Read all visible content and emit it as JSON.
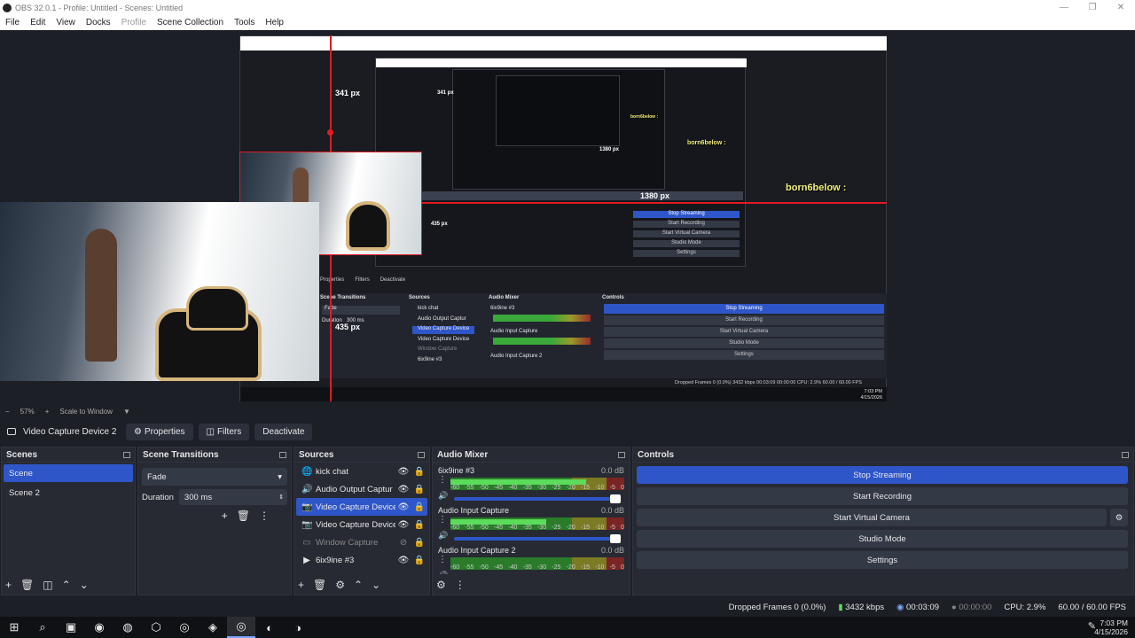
{
  "titlebar": {
    "title": "OBS 32.0.1 - Profile: Untitled - Scenes: Untitled",
    "minimize": "—",
    "maximize": "❐",
    "close": "✕"
  },
  "menu": [
    {
      "label": "File"
    },
    {
      "label": "Edit"
    },
    {
      "label": "View"
    },
    {
      "label": "Docks"
    },
    {
      "label": "Profile",
      "disabled": true
    },
    {
      "label": "Scene Collection"
    },
    {
      "label": "Tools"
    },
    {
      "label": "Help"
    }
  ],
  "preview": {
    "measure_top": "341 px",
    "measure_right": "1380 px",
    "measure_bottom": "435 px",
    "nested_measure_top": "341 px",
    "nested_measure_right": "1380 px",
    "nested_measure_bottom": "435 px",
    "chat_label_large": "born6below :",
    "chat_label_small": "born6below :",
    "chat_label_tiny": "born6below :",
    "nested_btn_stop": "Stop Streaming",
    "nested_btn_record": "Start Recording",
    "nested_btn_vcam": "Start Virtual Camera",
    "nested_btn_studio": "Studio Mode",
    "nested_btn_settings": "Settings",
    "nested_src_1": "kick chat",
    "nested_src_2": "Audio Output Captur",
    "nested_src_3": "Video Capture Device",
    "nested_src_4": "Video Capture Device",
    "nested_src_5": "Window Capture",
    "nested_src_6": "6ix9ine #3",
    "nested_status": "Dropped Frames 0 (0.0%)   3432 kbps   00:03:09   00:00:00   CPU: 2.9%   60.00 / 60.00 FPS",
    "nested_props": "Properties",
    "nested_filters": "Filters",
    "nested_deactivate": "Deactivate",
    "nested_fade": "Fade",
    "nested_duration": "Duration",
    "nested_dur_val": "300 ms",
    "nested_scene_trans": "Scene Transitions",
    "nested_sources": "Sources",
    "nested_mixer": "Audio Mixer",
    "nested_controls": "Controls",
    "nested_mix_1": "6ix9ine #3",
    "nested_mix_2": "Audio Input Capture",
    "nested_mix_3": "Audio Input Capture 2",
    "nested_clock_time": "7:03 PM",
    "nested_clock_date": "4/15/2026"
  },
  "zoom": {
    "minus": "−",
    "percent": "57%",
    "plus": "+",
    "mode": "Scale to Window",
    "arrow": "▼"
  },
  "source_bar": {
    "selected": "Video Capture Device 2",
    "properties": "Properties",
    "filters": "Filters",
    "deactivate": "Deactivate"
  },
  "scenes": {
    "title": "Scenes",
    "items": [
      {
        "label": "Scene",
        "selected": true
      },
      {
        "label": "Scene 2",
        "selected": false
      }
    ]
  },
  "transitions": {
    "title": "Scene Transitions",
    "selected": "Fade",
    "duration_label": "Duration",
    "duration_value": "300 ms"
  },
  "sources": {
    "title": "Sources",
    "items": [
      {
        "label": "kick chat",
        "icon": "globe-icon",
        "glyph": "🌐",
        "visible": true,
        "locked": true,
        "selected": false,
        "dim": false
      },
      {
        "label": "Audio Output Captur",
        "icon": "speaker-icon",
        "glyph": "🔊",
        "visible": true,
        "locked": true,
        "selected": false,
        "dim": false
      },
      {
        "label": "Video Capture Device",
        "icon": "camera-icon",
        "glyph": "📷",
        "visible": true,
        "locked": true,
        "selected": true,
        "dim": false
      },
      {
        "label": "Video Capture Device",
        "icon": "camera-icon",
        "glyph": "📷",
        "visible": true,
        "locked": true,
        "selected": false,
        "dim": false
      },
      {
        "label": "Window Capture",
        "icon": "window-icon",
        "glyph": "▭",
        "visible": false,
        "locked": true,
        "selected": false,
        "dim": true
      },
      {
        "label": "6ix9ine #3",
        "icon": "play-icon",
        "glyph": "▶",
        "visible": true,
        "locked": true,
        "selected": false,
        "dim": false
      }
    ]
  },
  "mixer": {
    "title": "Audio Mixer",
    "channels": [
      {
        "name": "6ix9ine #3",
        "db": "0.0 dB",
        "level": 0.78,
        "volume": 1.0
      },
      {
        "name": "Audio Input Capture",
        "db": "0.0 dB",
        "level": 0.55,
        "volume": 1.0
      },
      {
        "name": "Audio Input Capture 2",
        "db": "0.0 dB",
        "level": 0.0,
        "volume": 1.0
      }
    ],
    "ticks": [
      "-60",
      "-55",
      "-50",
      "-45",
      "-40",
      "-35",
      "-30",
      "-25",
      "-20",
      "-15",
      "-10",
      "-5",
      "0"
    ]
  },
  "controls": {
    "title": "Controls",
    "stop_streaming": "Stop Streaming",
    "start_recording": "Start Recording",
    "start_virtual_camera": "Start Virtual Camera",
    "studio_mode": "Studio Mode",
    "settings": "Settings"
  },
  "status": {
    "dropped": "Dropped Frames 0 (0.0%)",
    "bitrate": "3432 kbps",
    "stream_time": "00:03:09",
    "rec_time": "00:00:00",
    "cpu": "CPU: 2.9%",
    "fps": "60.00 / 60.00 FPS"
  },
  "taskbar": {
    "time": "7:03 PM",
    "date": "4/15/2026",
    "apps": [
      {
        "name": "windows-start-icon",
        "glyph": "⊞"
      },
      {
        "name": "search-icon",
        "glyph": "⌕"
      },
      {
        "name": "task-view-icon",
        "glyph": "▣"
      },
      {
        "name": "edge-icon",
        "glyph": "◉"
      },
      {
        "name": "firefox-icon",
        "glyph": "◍"
      },
      {
        "name": "store-icon",
        "glyph": "⬡"
      },
      {
        "name": "chrome-icon",
        "glyph": "◎"
      },
      {
        "name": "app-icon",
        "glyph": "◈"
      },
      {
        "name": "chrome-active-icon",
        "glyph": "◎",
        "active": true
      },
      {
        "name": "discord-icon",
        "glyph": "◐"
      },
      {
        "name": "obs-icon",
        "glyph": "◑"
      }
    ]
  },
  "colors": {
    "accent": "#2f56c9",
    "background": "#1d1f26",
    "panel": "#272a33",
    "measure_line": "#e01b24"
  }
}
